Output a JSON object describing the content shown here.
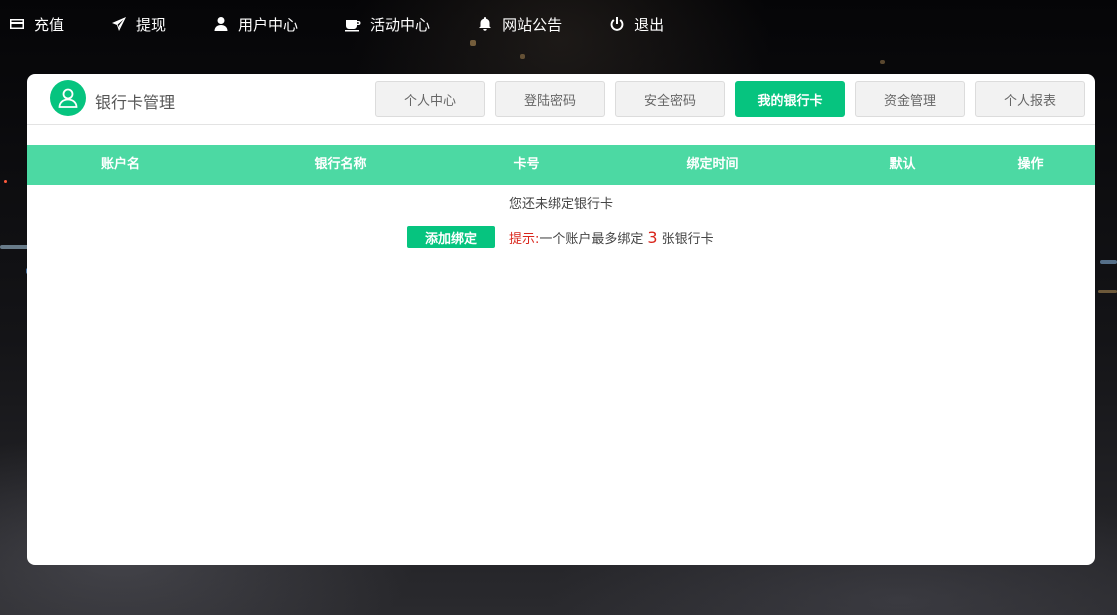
{
  "nav": [
    {
      "label": "充值",
      "icon": "card-icon"
    },
    {
      "label": "提现",
      "icon": "paper-plane-icon"
    },
    {
      "label": "用户中心",
      "icon": "user-icon"
    },
    {
      "label": "活动中心",
      "icon": "cup-icon"
    },
    {
      "label": "网站公告",
      "icon": "bell-icon"
    },
    {
      "label": "退出",
      "icon": "power-icon"
    }
  ],
  "panel": {
    "title": "银行卡管理",
    "avatar_icon": "user-avatar-icon",
    "tabs": [
      {
        "label": "个人中心",
        "active": false
      },
      {
        "label": "登陆密码",
        "active": false
      },
      {
        "label": "安全密码",
        "active": false
      },
      {
        "label": "我的银行卡",
        "active": true
      },
      {
        "label": "资金管理",
        "active": false
      },
      {
        "label": "个人报表",
        "active": false
      }
    ]
  },
  "table": {
    "columns": [
      "账户名",
      "银行名称",
      "卡号",
      "绑定时间",
      "默认",
      "操作"
    ],
    "empty_message": "您还未绑定银行卡"
  },
  "add": {
    "button_label": "添加绑定",
    "tip_label": "提示:",
    "tip_prefix": "一个账户最多绑定",
    "tip_count": "3",
    "tip_suffix": "张银行卡"
  },
  "colors": {
    "accent": "#06c47f",
    "table_header": "#4cd9a3",
    "tip": "#d9261c"
  }
}
